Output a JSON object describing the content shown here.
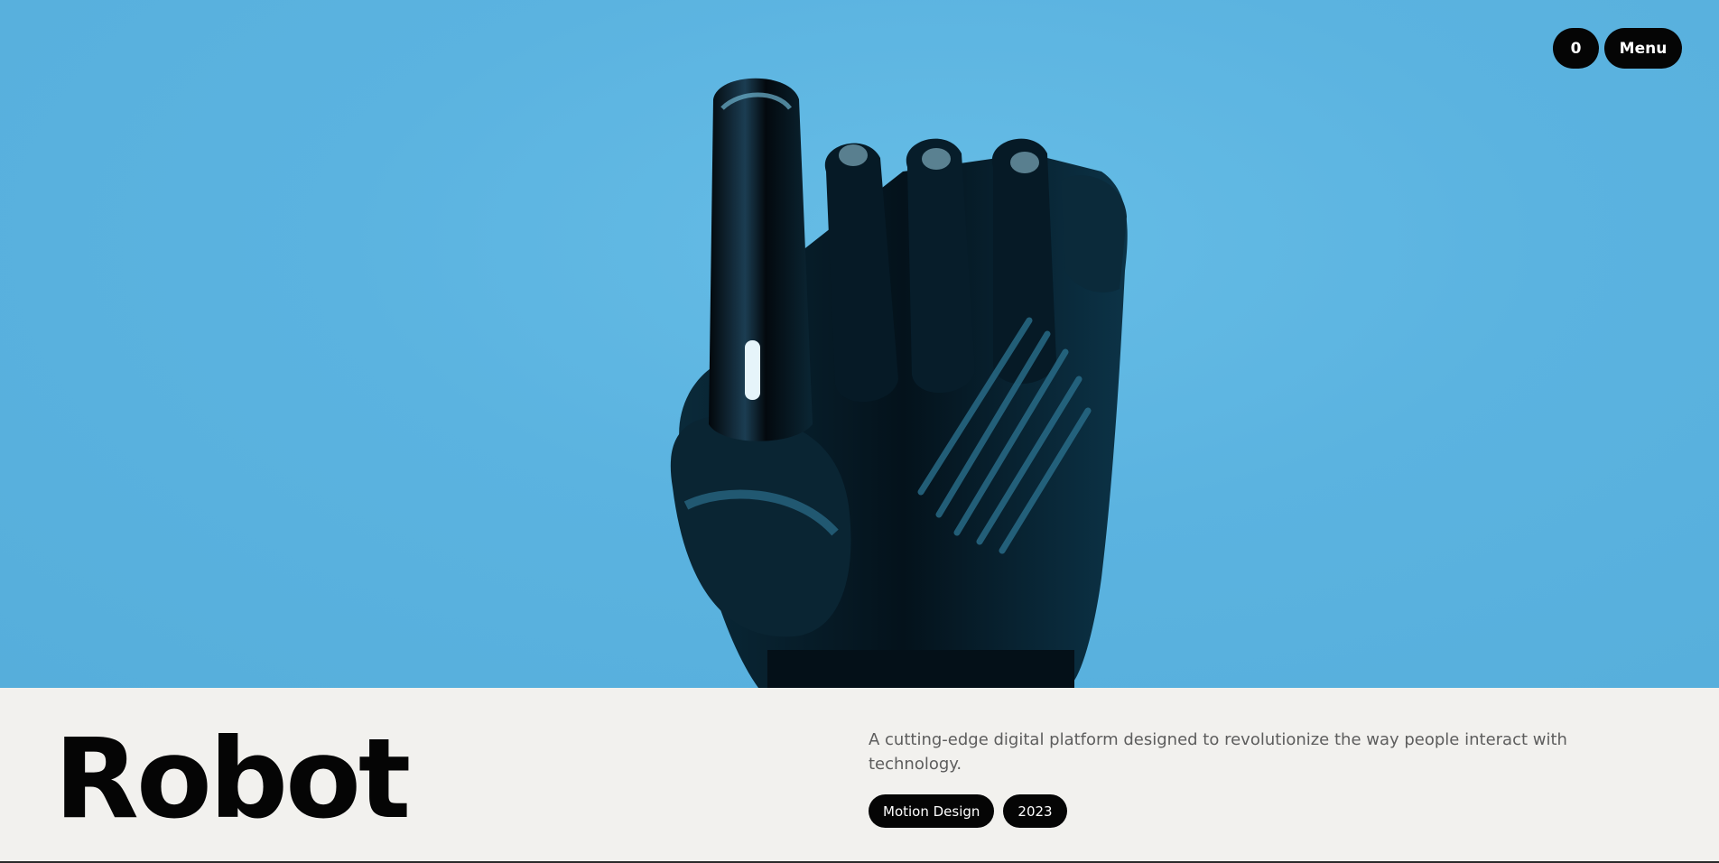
{
  "nav": {
    "cart_count": "0",
    "menu_label": "Menu"
  },
  "hero": {
    "image_subject": "robotic-hand-icon"
  },
  "project": {
    "title": "Robot",
    "description": "A cutting-edge digital platform designed to revolutionize the way people interact with technology.",
    "tags": [
      "Motion Design",
      "2023"
    ]
  },
  "colors": {
    "hero_background": "#5bb3e0",
    "pill_background": "#050505",
    "info_background": "#f2f1ee"
  }
}
